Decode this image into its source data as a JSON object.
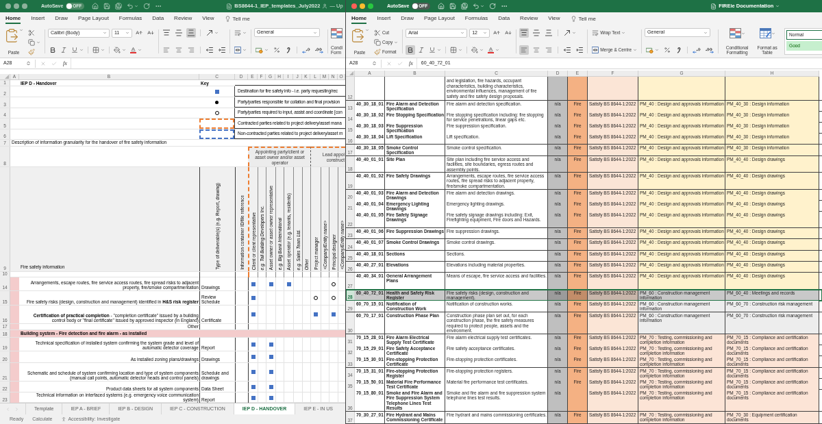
{
  "left_window": {
    "title_bar": {
      "active": false,
      "autosave": {
        "label": "AutoSave",
        "state_label": "OFF",
        "on": false
      },
      "title": "BS8644-1_IEP_templates_July2022",
      "shared": true,
      "title_suffix": "— Up"
    },
    "menu_tabs": [
      {
        "label": "Home",
        "selected": true
      },
      {
        "label": "Insert",
        "selected": false
      },
      {
        "label": "Draw",
        "selected": false
      },
      {
        "label": "Page Layout",
        "selected": false
      },
      {
        "label": "Formulas",
        "selected": false
      },
      {
        "label": "Data",
        "selected": false
      },
      {
        "label": "Review",
        "selected": false
      },
      {
        "label": "View",
        "selected": false
      }
    ],
    "tell_me": "Tell me",
    "ribbon": {
      "paste_label": "Paste",
      "font": "Calibri (Body)",
      "font_size": "11",
      "bold_on": false,
      "align_top": false,
      "align_middle": false,
      "align_bottom": true,
      "align_left": false,
      "align_center": false,
      "align_right": false,
      "number_format": "General",
      "conditional_formatting_label": "Condi Form"
    },
    "formula_bar": {
      "cell": "A28",
      "function_label": "fx"
    },
    "sheet": {
      "columns": [
        "A",
        "B",
        "C",
        "D",
        "E",
        "F",
        "G",
        "H",
        "I",
        "J",
        "K",
        "L",
        "M",
        "N",
        "O"
      ],
      "title_row": {
        "row": "1",
        "title": "IEP D - Handover",
        "key_label": "Key"
      },
      "key_rows": [
        {
          "row": "2",
          "kind": "square",
          "text": "Destination for fire safety info - i.e. party requesting/rec"
        },
        {
          "row": "3",
          "kind": "dot",
          "text": "Party/parties responsible for collation and final provision"
        },
        {
          "row": "4",
          "kind": "ring",
          "text": "Party/parties required to input, assist and coordinate [con"
        },
        {
          "row": "5",
          "kind": "contracted",
          "text": "Contracted parties related to project delivery/asset mana"
        },
        {
          "row": "6",
          "kind": "non_contracted",
          "text": "Non-contracted parties related to project delivery/asset m"
        }
      ],
      "description_row": {
        "row": "7",
        "text": "Description of information granularity for the handover of fire safety information"
      },
      "group_row": {
        "row": "8",
        "groups": [
          {
            "label": "Appointing party/client or asset owner and/or asset operator"
          },
          {
            "label_lines": [
              "Lead appoi",
              "construct"
            ]
          }
        ]
      },
      "header_row": {
        "row": "9",
        "label": "Fire safety information",
        "columns": [
          {
            "text": "Type of deliverable(s) (e.g. Report, drawing)",
            "italic": false
          },
          {
            "text": "Information container ID/file reference",
            "italic": false
          },
          {
            "text": "Client or client representative",
            "italic": false
          },
          {
            "text": "e.g. Tall Building Developers Inc.",
            "italic": true
          },
          {
            "text": "Asset owner or asset owner representative",
            "italic": false
          },
          {
            "text": "e.g. Big Bank International",
            "italic": true
          },
          {
            "text": "Asset operator (e.g. tenants, residents)",
            "italic": false
          },
          {
            "text": "e.g. Sales Team Ltd.",
            "italic": true
          },
          {
            "text": "Other",
            "italic": false
          },
          {
            "text": "Project manager",
            "italic": false
          },
          {
            "text": "<Company/Entity name>",
            "italic": true
          },
          {
            "text": "Principal designer",
            "italic": false
          },
          {
            "text": "<Company/Entity name>",
            "italic": true
          }
        ]
      },
      "blank_row": {
        "row": "10"
      },
      "rows": [
        {
          "row": "14",
          "kind": "item",
          "text": "Arrangements, escape routes, fire service access routes, fire spread risks to adjacent property, fire/smoke compartmentation",
          "type": "Drawings",
          "marks": [
            {
              "kind": "square"
            },
            {
              "kind": "empty"
            },
            {
              "kind": "square"
            },
            {
              "kind": "empty"
            },
            {
              "kind": "square"
            },
            {
              "kind": "empty"
            },
            {
              "kind": "empty"
            },
            {
              "kind": "empty"
            },
            {
              "kind": "empty"
            },
            {
              "kind": "ring"
            },
            {
              "kind": "empty"
            }
          ]
        },
        {
          "row": "15",
          "kind": "item",
          "text": "Fire safety risks (design, construction and management) identified in **H&S risk register**",
          "type": "Review Schedule",
          "marks": [
            {
              "kind": "square"
            },
            {
              "kind": "empty"
            },
            {
              "kind": "empty"
            },
            {
              "kind": "empty"
            },
            {
              "kind": "empty"
            },
            {
              "kind": "empty"
            },
            {
              "kind": "empty"
            },
            {
              "kind": "ring"
            },
            {
              "kind": "empty"
            },
            {
              "kind": "ring"
            },
            {
              "kind": "empty"
            }
          ]
        },
        {
          "row": "16",
          "kind": "item",
          "text": "**Certification of practical completion** - \"completion certificate\" issued by a building control body or \"final certificate\" issued by approved inspector (in England)",
          "type": "Certificate",
          "marks": [
            {
              "kind": "square"
            },
            {
              "kind": "empty"
            },
            {
              "kind": "empty"
            },
            {
              "kind": "empty"
            },
            {
              "kind": "empty"
            },
            {
              "kind": "empty"
            },
            {
              "kind": "empty"
            },
            {
              "kind": "square"
            },
            {
              "kind": "empty"
            },
            {
              "kind": "square"
            },
            {
              "kind": "empty"
            }
          ]
        },
        {
          "row": "17",
          "kind": "item",
          "text": "Other"
        },
        {
          "row": "18",
          "kind": "section",
          "text": "Building system - Fire detection and fire alarm - as installed"
        },
        {
          "row": "19",
          "kind": "item",
          "text": "Technical specification of installed system confirming the system grade and level of automatic detector coverage",
          "type": "Report",
          "marks": [
            {
              "kind": "square"
            },
            {
              "kind": "empty"
            },
            {
              "kind": "square"
            },
            {
              "kind": "empty"
            },
            {
              "kind": "empty"
            },
            {
              "kind": "empty"
            },
            {
              "kind": "empty"
            },
            {
              "kind": "empty"
            },
            {
              "kind": "empty"
            },
            {
              "kind": "empty"
            },
            {
              "kind": "empty"
            }
          ]
        },
        {
          "row": "20",
          "kind": "item",
          "text": "As installed zoning plans/drawings",
          "type": "Drawings",
          "marks": [
            {
              "kind": "square"
            },
            {
              "kind": "empty"
            },
            {
              "kind": "square"
            },
            {
              "kind": "empty"
            },
            {
              "kind": "empty"
            },
            {
              "kind": "empty"
            },
            {
              "kind": "empty"
            },
            {
              "kind": "empty"
            },
            {
              "kind": "empty"
            },
            {
              "kind": "empty"
            },
            {
              "kind": "empty"
            }
          ]
        },
        {
          "row": "21",
          "kind": "item",
          "text": "Schematic and schedule of system confirming location and type of system components (manual call points, automatic detector heads and control panels)",
          "type": "Schedule and drawings",
          "marks": [
            {
              "kind": "square"
            },
            {
              "kind": "empty"
            },
            {
              "kind": "square"
            },
            {
              "kind": "empty"
            },
            {
              "kind": "empty"
            },
            {
              "kind": "empty"
            },
            {
              "kind": "empty"
            },
            {
              "kind": "empty"
            },
            {
              "kind": "empty"
            },
            {
              "kind": "empty"
            },
            {
              "kind": "empty"
            }
          ]
        },
        {
          "row": "22",
          "kind": "item",
          "text": "Product data sheets for all system components",
          "type": "Data Sheet",
          "marks": [
            {
              "kind": "square"
            },
            {
              "kind": "empty"
            },
            {
              "kind": "square"
            },
            {
              "kind": "empty"
            },
            {
              "kind": "empty"
            },
            {
              "kind": "empty"
            },
            {
              "kind": "empty"
            },
            {
              "kind": "empty"
            },
            {
              "kind": "empty"
            },
            {
              "kind": "empty"
            },
            {
              "kind": "empty"
            }
          ]
        },
        {
          "row": "23",
          "kind": "item",
          "text": "Technical information on interfaced systems (e.g. emergency voice communication system)",
          "type": "Report",
          "marks": [
            {
              "kind": "square"
            },
            {
              "kind": "empty"
            },
            {
              "kind": "square"
            },
            {
              "kind": "empty"
            },
            {
              "kind": "empty"
            },
            {
              "kind": "empty"
            },
            {
              "kind": "empty"
            },
            {
              "kind": "empty"
            },
            {
              "kind": "empty"
            },
            {
              "kind": "empty"
            },
            {
              "kind": "empty"
            }
          ]
        }
      ]
    },
    "sheet_tabs": [
      {
        "label": "Template",
        "selected": false
      },
      {
        "label": "IEP A - BRIEF",
        "selected": false
      },
      {
        "label": "IEP B - DESIGN",
        "selected": false
      },
      {
        "label": "IEP C - CONSTRUCTION",
        "selected": false
      },
      {
        "label": "IEP D - HANDOVER",
        "selected": true
      },
      {
        "label": "IEP E - IN US",
        "selected": false
      }
    ],
    "status_bar": {
      "ready": "Ready",
      "calculate": "Calculate",
      "accessibility": "Accessibility: Investigate"
    }
  },
  "right_window": {
    "title_bar": {
      "active": true,
      "autosave": {
        "label": "AutoSave",
        "state_label": "OFF",
        "on": false
      },
      "title": "FIREie Documentation"
    },
    "menu_tabs": [
      {
        "label": "Home",
        "selected": true
      },
      {
        "label": "Insert",
        "selected": false
      },
      {
        "label": "Draw",
        "selected": false
      },
      {
        "label": "Page Layout",
        "selected": false
      },
      {
        "label": "Formulas",
        "selected": false
      },
      {
        "label": "Data",
        "selected": false
      },
      {
        "label": "Review",
        "selected": false
      },
      {
        "label": "View",
        "selected": false
      }
    ],
    "tell_me": "Tell me",
    "ribbon": {
      "paste_label": "Paste",
      "cut_label": "Cut",
      "copy_label": "Copy",
      "format_label": "Format",
      "font": "Arial",
      "font_size": "12",
      "bold_on": true,
      "align_top": true,
      "align_middle": false,
      "align_bottom": false,
      "align_left": true,
      "align_center": false,
      "align_right": false,
      "wrap_text_label": "Wrap Text",
      "merge_label": "Merge & Centre",
      "number_format": "General",
      "conditional_formatting_label": "Conditional Formatting",
      "format_as_table_label": "Format as Table",
      "styles": [
        {
          "label": "Normal",
          "kind": "normal",
          "selected": true
        },
        {
          "label": "Good",
          "kind": "good",
          "selected": false
        }
      ]
    },
    "formula_bar": {
      "cell": "A28",
      "function_label": "fx",
      "formula": "60_40_72_01"
    },
    "sheet": {
      "columns": [
        "A",
        "B",
        "C",
        "D",
        "E",
        "F",
        "G",
        "H"
      ],
      "rows": [
        {
          "row": "12",
          "column_c": "and legislation, fire hazards, occupant characteristics, building characteristics, environmental influences, management of fire safety and fire safety design proposals.",
          "color": "#fff2cc",
          "selected": false
        },
        {
          "row": "13",
          "column_a": "40_30_18_01",
          "column_b": "Fire Alarm and Detection Specification",
          "column_c": "Fire alarm and detection specification.",
          "column_d": "n/a",
          "column_e": "Fire",
          "column_f": "Satisfy BS 8644-1:2022",
          "column_g": "PM_40 : Design and approvals information",
          "column_h": "PM_40_30 : Design information",
          "color": "#fff2cc",
          "selected": false
        },
        {
          "row": "14",
          "column_a": "40_30_18_02",
          "column_b": "Fire Stopping Specification",
          "column_c": "Fire stopping specification including: fire stopping for service penetrations, linear gaps etc.",
          "column_d": "n/a",
          "column_e": "Fire",
          "column_f": "Satisfy BS 8644-1:2022",
          "column_g": "PM_40 : Design and approvals information",
          "column_h": "PM_40_30 : Design information",
          "color": "#fff2cc",
          "selected": false
        },
        {
          "row": "15",
          "column_a": "40_30_18_03",
          "column_b": "Fire Suppression Specification",
          "column_c": "Fire suppression specification.",
          "column_d": "n/a",
          "column_e": "Fire",
          "column_f": "Satisfy BS 8644-1:2022",
          "column_g": "PM_40 : Design and approvals information",
          "column_h": "PM_40_30 : Design information",
          "color": "#fff2cc",
          "selected": false
        },
        {
          "row": "16",
          "column_a": "40_30_18_04",
          "column_b": "Lift Specification",
          "column_c": "Lift specification.",
          "column_d": "n/a",
          "column_e": "Fire",
          "column_f": "Satisfy BS 8644-1:2022",
          "column_g": "PM_40 : Design and approvals information",
          "column_h": "PM_40_30 : Design information",
          "color": "#fff2cc",
          "selected": false
        },
        {
          "row": "17",
          "column_a": "40_30_18_05",
          "column_b": "Smoke Control Specification",
          "column_c": "Smoke control specification.",
          "column_d": "n/a",
          "column_e": "Fire",
          "column_f": "Satisfy BS 8644-1:2022",
          "column_g": "PM_40 : Design and approvals information",
          "column_h": "PM_40_30 : Design information",
          "color": "#fff2cc",
          "selected": false
        },
        {
          "row": "18",
          "column_a": "40_40_01_01",
          "column_b": "Site Plan",
          "column_c": "Site plan including fire service access and facilities, site boundaries, egress routes and assembly points.",
          "column_d": "n/a",
          "column_e": "Fire",
          "column_f": "Satisfy BS 8644-1:2022",
          "column_g": "PM_40 : Design and approvals information",
          "column_h": "PM_40_40 : Design drawings",
          "color": "#fff2cc",
          "selected": false
        },
        {
          "row": "19",
          "column_a": "40_40_01_02",
          "column_b": "Fire Safety Drawings",
          "column_c": "Arrangements, escape routes, fire service access routes, fire spread risks to adjacent property, fire/smoke compartmentation.",
          "column_d": "n/a",
          "column_e": "Fire",
          "column_f": "Satisfy BS 8644-1:2022",
          "column_g": "PM_40 : Design and approvals information",
          "column_h": "PM_40_40 : Design drawings",
          "color": "#fff2cc",
          "selected": false
        },
        {
          "row": "20",
          "column_a": "40_40_01_03",
          "column_b": "Fire Alarm and Detection Drawings",
          "column_c": "Fire alarm and detection drawings.",
          "column_d": "n/a",
          "column_e": "Fire",
          "column_f": "Satisfy BS 8644-1:2022",
          "column_g": "PM_40 : Design and approvals information",
          "column_h": "PM_40_40 : Design drawings",
          "color": "#fff2cc",
          "selected": false
        },
        {
          "row": "21",
          "column_a": "40_40_01_04",
          "column_b": "Emergency Lighting Drawings",
          "column_c": "Emergency lighting drawings.",
          "column_d": "n/a",
          "column_e": "Fire",
          "column_f": "Satisfy BS 8644-1:2022",
          "column_g": "PM_40 : Design and approvals information",
          "column_h": "PM_40_40 : Design drawings",
          "color": "#fff2cc",
          "selected": false
        },
        {
          "row": "22",
          "column_a": "40_40_01_05",
          "column_b": "Fire Safety Signage Drawings",
          "column_c": "Fire safety signage drawings including: Exit, Firefighting equipment, Fire doors and Hazards.",
          "column_d": "n/a",
          "column_e": "Fire",
          "column_f": "Satisfy BS 8644-1:2022",
          "column_g": "PM_40 : Design and approvals information",
          "column_h": "PM_40_40 : Design drawings",
          "color": "#fff2cc",
          "selected": false
        },
        {
          "row": "23",
          "column_a": "40_40_01_06",
          "column_b": "Fire Suppression Drawings",
          "column_c": "Fire suppression drawings.",
          "column_d": "n/a",
          "column_e": "Fire",
          "column_f": "Satisfy BS 8644-1:2022",
          "column_g": "PM_40 : Design and approvals information",
          "column_h": "PM_40_40 : Design drawings",
          "color": "#fff2cc",
          "selected": false
        },
        {
          "row": "24",
          "column_a": "40_40_01_07",
          "column_b": "Smoke Control Drawings",
          "column_c": "Smoke control drawings.",
          "column_d": "n/a",
          "column_e": "Fire",
          "column_f": "Satisfy BS 8644-1:2022",
          "column_g": "PM_40 : Design and approvals information",
          "column_h": "PM_40_40 : Design drawings",
          "color": "#fff2cc",
          "selected": false
        },
        {
          "row": "25",
          "column_a": "40_40_18_01",
          "column_b": "Sections",
          "column_c": "Sections.",
          "column_d": "n/a",
          "column_e": "Fire",
          "column_f": "Satisfy BS 8644-1:2022",
          "column_g": "PM_40 : Design and approvals information",
          "column_h": "PM_40_40 : Design drawings",
          "color": "#fff2cc",
          "selected": false
        },
        {
          "row": "26",
          "column_a": "40_40_27_01",
          "column_b": "Elevations",
          "column_c": "Elevations including material properties.",
          "column_d": "n/a",
          "column_e": "Fire",
          "column_f": "Satisfy BS 8644-1:2022",
          "column_g": "PM_40 : Design and approvals information",
          "column_h": "PM_40_40 : Design drawings",
          "color": "#fff2cc",
          "selected": false
        },
        {
          "row": "27",
          "column_a": "40_40_34_01",
          "column_b": "General Arrangement Plans",
          "column_c": "Means of escape, fire service access and facilities.",
          "column_d": "n/a",
          "column_e": "Fire",
          "column_f": "Satisfy BS 8644-1:2022",
          "column_g": "PM_40 : Design and approvals information",
          "column_h": "PM_40_40 : Design drawings",
          "color": "#fff2cc",
          "selected": false
        },
        {
          "row": "28",
          "column_a": "60_40_72_01",
          "column_b": "Health and Safety Risk Register",
          "column_c": "Fire safety risks (design, construction and management).",
          "column_d": "n/a",
          "column_e": "Fire",
          "column_f": "Satisfy BS 8644-1:2022",
          "column_g": "PM_60 : Construction management information",
          "column_h": "PM_60_40 : Meetings and records",
          "color": "#c9c9c9",
          "selected": true
        },
        {
          "row": "29",
          "column_a": "60_70_15_01",
          "column_b": "Notification of Construction Work",
          "column_c": "Notification of construction works.",
          "column_d": "n/a",
          "column_e": "Fire",
          "column_f": "Satisfy BS 8644-1:2022",
          "column_g": "PM_60 : Construction management information",
          "column_h": "PM_60_70 : Construction risk management",
          "color": "#ededed",
          "selected": false
        },
        {
          "row": "30",
          "column_a": "60_70_17_01",
          "column_b": "Construction Phase Plan",
          "column_c": "Construction phase plan set out, for each construction phase, the fire safety measures required to protect people, assets and the environment.",
          "column_d": "n/a",
          "column_e": "Fire",
          "column_f": "Satisfy BS 8644-1:2022",
          "column_g": "PM_60 : Construction management information",
          "column_h": "PM_60_70 : Construction risk management",
          "color": "#ededed",
          "selected": false
        },
        {
          "row": "31",
          "column_a": "70_15_28_01",
          "column_b": "Fire Alarm Electrical Supply Test Certificate",
          "column_c": "Fire alarm electrical supply test certificates.",
          "column_d": "n/a",
          "column_e": "Fire",
          "column_f": "Satisfy BS 8644-1:2022",
          "column_g": "PM_70 : Testing, commissioning and completion information",
          "column_h": "PM_70_15 : Compliance and certification documents",
          "color": "#fce4d6",
          "selected": false
        },
        {
          "row": "32",
          "column_a": "70_15_29_01",
          "column_b": "Fire Safety Acceptance Certificate",
          "column_c": "Fire safety acceptance certificates.",
          "column_d": "n/a",
          "column_e": "Fire",
          "column_f": "Satisfy BS 8644-1:2022",
          "column_g": "PM_70 : Testing, commissioning and completion information",
          "column_h": "PM_70_15 : Compliance and certification documents",
          "color": "#fce4d6",
          "selected": false
        },
        {
          "row": "33",
          "column_a": "70_15_30_01",
          "column_b": "Fire-stopping Protection Certificate",
          "column_c": "Fire-stopping protection certificates.",
          "column_d": "n/a",
          "column_e": "Fire",
          "column_f": "Satisfy BS 8644-1:2022",
          "column_g": "PM_70 : Testing, commissioning and completion information",
          "column_h": "PM_70_15 : Compliance and certification documents",
          "color": "#fce4d6",
          "selected": false
        },
        {
          "row": "34",
          "column_a": "70_15_31_01",
          "column_b": "Fire-stopping Protection Register",
          "column_c": "Fire-stopping protection registers.",
          "column_d": "n/a",
          "column_e": "Fire",
          "column_f": "Satisfy BS 8644-1:2022",
          "column_g": "PM_70 : Testing, commissioning and completion information",
          "column_h": "PM_70_15 : Compliance and certification documents",
          "color": "#fce4d6",
          "selected": false
        },
        {
          "row": "35",
          "column_a": "70_15_50_01",
          "column_b": "Material Fire Performance Test Certificate",
          "column_c": "Material fire performance test certificates.",
          "column_d": "n/a",
          "column_e": "Fire",
          "column_f": "Satisfy BS 8644-1:2022",
          "column_g": "PM_70 : Testing, commissioning and completion information",
          "column_h": "PM_70_15 : Compliance and certification documents",
          "color": "#fce4d6",
          "selected": false
        },
        {
          "row": "36",
          "column_a": "70_15_80_01",
          "column_b": "Smoke and Fire Alarm and Fire Suppression System Telephone Lines Test Results",
          "column_c": "Smoke and fire alarm and fire suppression system telephone lines test results.",
          "column_d": "n/a",
          "column_f": "Satisfy BS 8644-1:2022",
          "column_g": "PM_70 : Testing, commissioning and completion information",
          "column_h": "PM_70_15 : Compliance and certification documents",
          "color": "#fce4d6",
          "selected": false
        },
        {
          "row": "37",
          "column_a": "70_30_27_01",
          "column_b": "Fire Hydrant and Mains Commissioning Certificate",
          "column_c": "Fire hydrant and mains commissioning certificates.",
          "column_d": "n/a",
          "column_e": "Fire",
          "column_f": "Satisfy BS 8644-1:2022",
          "column_g": "PM_70 : Testing, commissioning and completion information",
          "column_h": "PM_70_30 : Equipment certification documents",
          "color": "#fce4d6",
          "selected": false
        }
      ]
    }
  }
}
